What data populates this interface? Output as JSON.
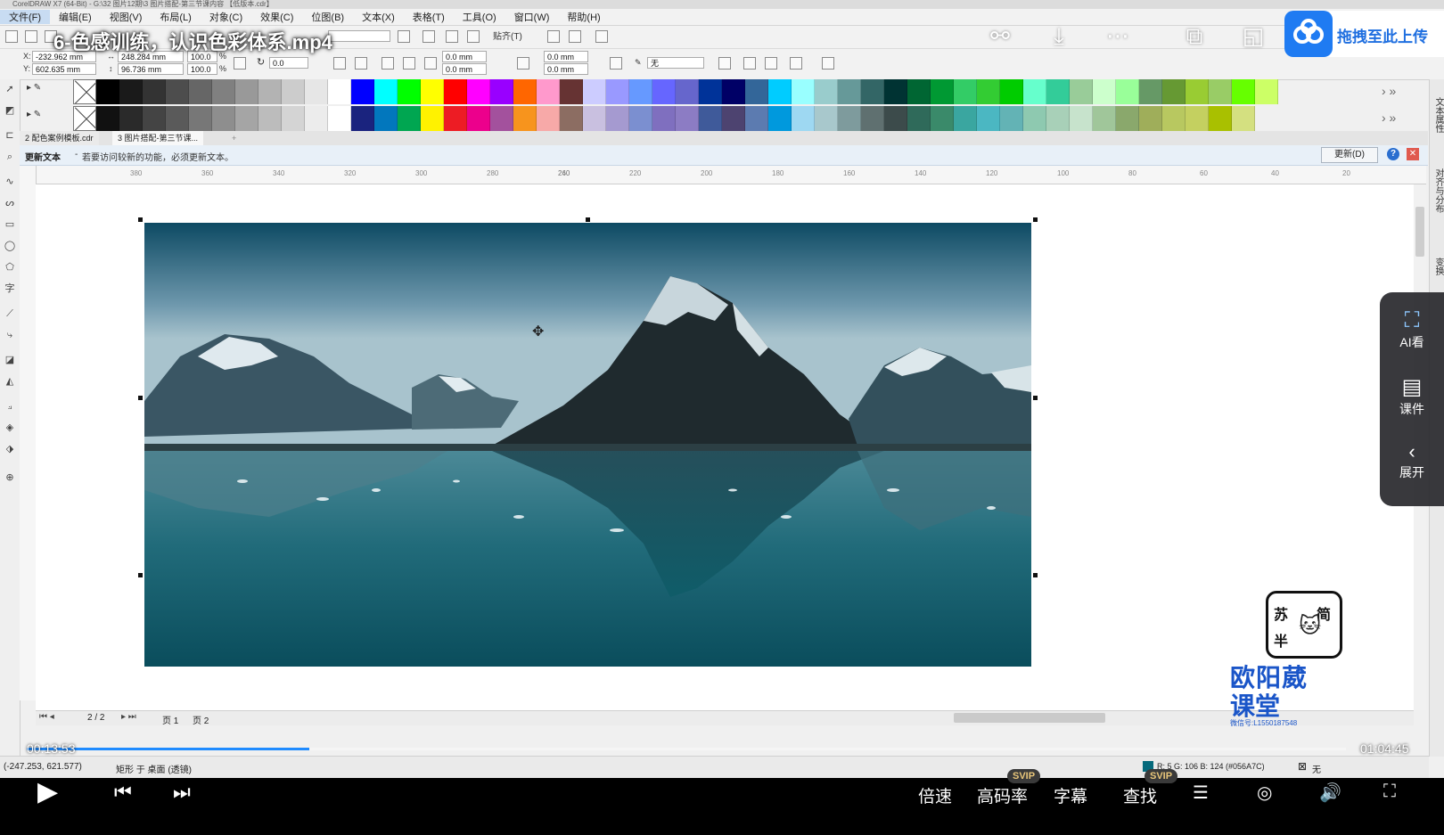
{
  "app": {
    "window_title": "CorelDRAW X7 (64-Bit) - G:\\32 图片12期\\3 图片搭配-第三节课内容 【低版本.cdr】",
    "menu": [
      "文件(F)",
      "编辑(E)",
      "视图(V)",
      "布局(L)",
      "对象(C)",
      "效果(C)",
      "位图(B)",
      "文本(X)",
      "表格(T)",
      "工具(O)",
      "窗口(W)",
      "帮助(H)"
    ],
    "toolbar": {
      "snap_label": "贴齐(T)"
    },
    "props": {
      "x": "-232.962 mm",
      "y": "602.635 mm",
      "width": "248.284 mm",
      "height": "96.736 mm",
      "scale_x": "100.0",
      "scale_y": "100.0",
      "pct": "%",
      "rotation": "0.0",
      "corner_1": "0.0 mm",
      "corner_2": "0.0 mm",
      "corner_3": "0.0 mm",
      "corner_4": "0.0 mm",
      "outline": "无"
    },
    "tabs": [
      "2 配色案例模板.cdr",
      "3 图片搭配-第三节课..."
    ],
    "infobar": {
      "title": "更新文本",
      "message": "若要访问较新的功能，必须更新文本。",
      "button": "更新(D)"
    },
    "ruler_ticks": [
      "380",
      "360",
      "340",
      "320",
      "300",
      "280",
      "260",
      "240",
      "220",
      "200",
      "180",
      "160",
      "140",
      "120",
      "100",
      "80",
      "60",
      "40",
      "20"
    ],
    "pages": {
      "counter": "2 / 2",
      "tab1": "页 1",
      "tab2": "页 2"
    },
    "status": {
      "coords": "(-247.253, 621.577)",
      "object": "矩形 于 桌面 (透镜)",
      "fill_info": "R: 5 G: 106 B: 124 (#056A7C)",
      "outline_info": "无"
    },
    "right_dock": [
      "文本属性",
      "对齐与分布",
      "变换"
    ]
  },
  "colors": {
    "palette_row1": [
      "#000000",
      "#1a1a1a",
      "#333333",
      "#4d4d4d",
      "#666666",
      "#808080",
      "#999999",
      "#b3b3b3",
      "#cccccc",
      "#e6e6e6",
      "#ffffff",
      "#0000ff",
      "#00ffff",
      "#00ff00",
      "#ffff00",
      "#ff0000",
      "#ff00ff",
      "#9900ff",
      "#ff6600",
      "#ff99cc",
      "#663333",
      "#ccccff",
      "#9999ff",
      "#6699ff",
      "#6666ff",
      "#6666cc",
      "#003399",
      "#000066",
      "#336699",
      "#00ccff",
      "#99ffff",
      "#99cccc",
      "#669999",
      "#336666",
      "#003333",
      "#006633",
      "#009933",
      "#33cc66",
      "#33cc33",
      "#00cc00",
      "#66ffcc",
      "#33cc99",
      "#99cc99",
      "#ccffcc",
      "#99ff99",
      "#669966",
      "#669933",
      "#99cc33",
      "#99cc66",
      "#66ff00",
      "#ccff66"
    ],
    "palette_row2": [
      "#111111",
      "#2a2a2a",
      "#444444",
      "#5a5a5a",
      "#777777",
      "#8e8e8e",
      "#a5a5a5",
      "#bcbcbc",
      "#d4d4d4",
      "#ececec",
      "#ffffff",
      "#1a237e",
      "#0277bd",
      "#00a651",
      "#fff200",
      "#ed1c24",
      "#ec008c",
      "#a3519d",
      "#f7941d",
      "#f7a9a8",
      "#8c6d62",
      "#c9c0e0",
      "#a59ad0",
      "#7b8fd0",
      "#7f6fbf",
      "#8c7cc4",
      "#3f5a9a",
      "#4d4370",
      "#5c7bb0",
      "#0099dd",
      "#9ed8f2",
      "#a8c8cc",
      "#7e9b9d",
      "#5f7070",
      "#3c4b4b",
      "#2f6a5a",
      "#3a8a6a",
      "#3aa6a0",
      "#4bb7c2",
      "#63b3b5",
      "#8ec9b0",
      "#a8d0b8",
      "#c7e3cc",
      "#a0c69a",
      "#8aa86c",
      "#9fae5a",
      "#b8c860",
      "#c4d060",
      "#a9c000",
      "#d4e080"
    ],
    "accent": "#1f7bf2",
    "progress": "#1f8bff"
  },
  "player": {
    "title": "6-色感训练，认识色彩体系.mp4",
    "upload_label": "拖拽至此上传",
    "current_time": "00:13:53",
    "total_time": "01:04:45",
    "progress": 0.214,
    "side_panel": {
      "ai": "AI看",
      "course": "课件",
      "expand": "展开"
    },
    "controls": {
      "speed": "倍速",
      "quality": "高码率",
      "subtitle": "字幕",
      "search": "查找",
      "svip": "SVIP"
    }
  },
  "watermark": {
    "line1": "欧阳葳",
    "line2": "课堂",
    "wechat": "微信号:L1550187548",
    "chars": [
      "苏",
      "简",
      "半"
    ]
  }
}
